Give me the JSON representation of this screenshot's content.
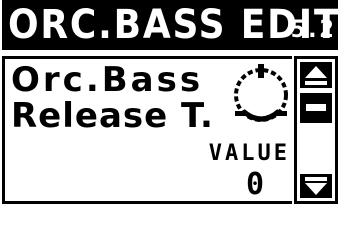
{
  "header": {
    "title": "ORC.BASS EDIT",
    "page_number": "5.2"
  },
  "parameter": {
    "line1": "Orc.Bass",
    "line2": "Release T.",
    "value_label": "VALUE",
    "value": "0"
  },
  "scrollbar": {
    "up_icon": "scroll-up-arrow-icon",
    "down_icon": "scroll-down-arrow-icon",
    "position": 0
  },
  "colors": {
    "foreground": "#000000",
    "background": "#ffffff"
  }
}
